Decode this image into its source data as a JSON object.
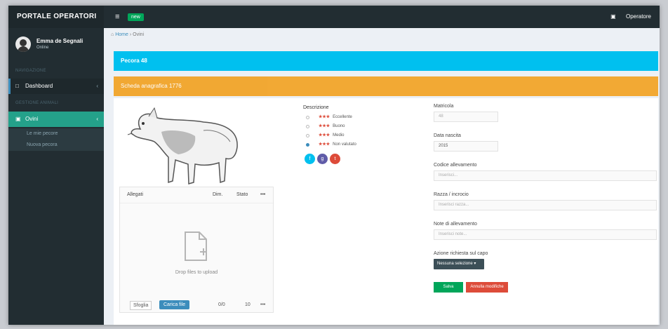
{
  "app": {
    "brand": "PORTALE OPERATORI",
    "badge": "new"
  },
  "topbar": {
    "menu_glyph": "≡",
    "user_glyph": "▣",
    "user_label": "Operatore"
  },
  "user": {
    "name": "Emma de Segnali",
    "status": "Online"
  },
  "sidebar": {
    "header1": "NAVIGAZIONE",
    "item_dashboard": "Dashboard",
    "header2": "GESTIONE ANIMALI",
    "item_animali": "Ovini",
    "sub1": "Le mie pecore",
    "sub2": "Nuova pecora",
    "chev": "‹"
  },
  "breadcrumb": {
    "home": "Home",
    "sep": "›",
    "current": "Ovini"
  },
  "main": {
    "cyan_title": "Pecora 48",
    "orange_title": "Scheda anagrafica 1776"
  },
  "dropzone": {
    "col1": "Allegati",
    "col2": "Dim.",
    "col3": "Stato",
    "col4": "•••",
    "drop_text": "Drop files to upload",
    "btn_browse": "Sfoglia",
    "btn_upload": "Carica file",
    "f1": "0/0",
    "f2": "10",
    "f3": "•••"
  },
  "description": {
    "title": "Descrizione",
    "rows": [
      {
        "stars": "★★★",
        "text": "Eccellente",
        "checked": false
      },
      {
        "stars": "★★★",
        "text": "Buono",
        "checked": false
      },
      {
        "stars": "★★★",
        "text": "Medio",
        "checked": false
      },
      {
        "stars": "★★★",
        "text": "Non valutato",
        "checked": true
      }
    ],
    "circles": [
      {
        "glyph": "f",
        "color": "#00c0ef"
      },
      {
        "glyph": "g",
        "color": "#605ca8"
      },
      {
        "glyph": "t",
        "color": "#dd4b39"
      }
    ]
  },
  "form": {
    "f1_label": "Matricola",
    "f1_value": "48",
    "f2_label": "Data nascita",
    "f2_value": "2015",
    "f3_label": "Codice allevamento",
    "f3_placeholder": "Inserisci...",
    "f4_label": "Razza / incrocio",
    "f4_placeholder": "Inserisci razza...",
    "f5_label": "Note di allevamento",
    "f5_placeholder": "Inserisci note...",
    "f6_label": "Azione richiesta sul capo",
    "f6_select": "Nessuna selezione",
    "btn_save": "Salva",
    "btn_cancel": "Annulla modifiche"
  },
  "colors": {
    "cyan": "#00c0ef",
    "orange": "#f39c12",
    "sidebar": "#222d32",
    "accent": "#3c8dbc"
  },
  "icons": {
    "sheep_image": "sheep-image",
    "file_add": "file-add-icon"
  }
}
